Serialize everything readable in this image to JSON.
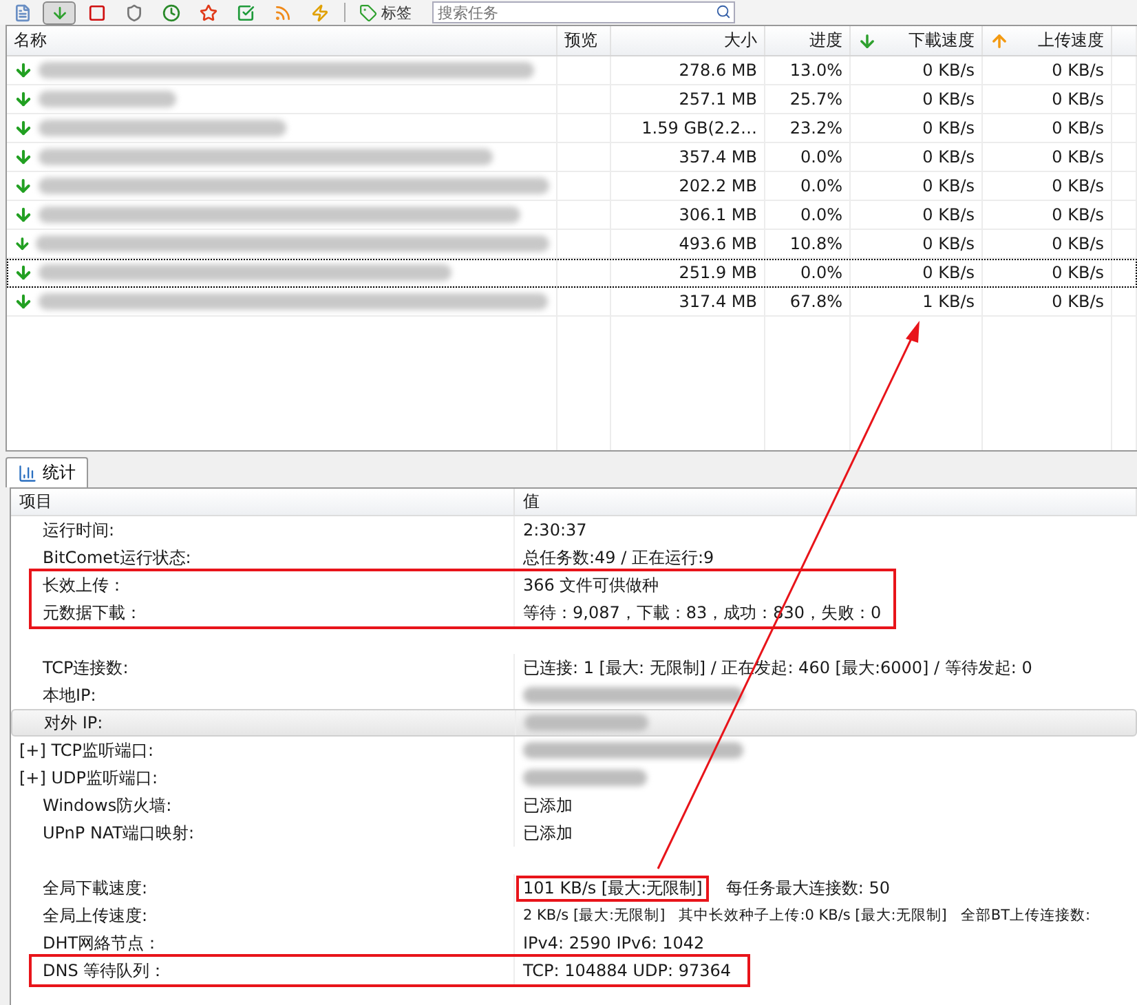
{
  "toolbar": {
    "buttons": [
      {
        "selected": false
      },
      {
        "selected": true
      },
      {
        "selected": false
      },
      {
        "selected": false
      },
      {
        "selected": false
      },
      {
        "selected": false
      },
      {
        "selected": false
      },
      {
        "selected": false
      },
      {
        "selected": false
      }
    ],
    "tag_button": "标签",
    "search": {
      "placeholder": "搜索任务"
    }
  },
  "tasks": {
    "columns": [
      "名称",
      "预览",
      "大小",
      "进度",
      "下載速度",
      "上传速度"
    ],
    "rows": [
      {
        "size": "278.6 MB",
        "progress": "13.0%",
        "down": "0 KB/s",
        "up": "0 KB/s",
        "focused": false
      },
      {
        "size": "257.1 MB",
        "progress": "25.7%",
        "down": "0 KB/s",
        "up": "0 KB/s",
        "focused": false
      },
      {
        "size": "1.59 GB(2.2…",
        "progress": "23.2%",
        "down": "0 KB/s",
        "up": "0 KB/s",
        "focused": false
      },
      {
        "size": "357.4 MB",
        "progress": "0.0%",
        "down": "0 KB/s",
        "up": "0 KB/s",
        "focused": false
      },
      {
        "size": "202.2 MB",
        "progress": "0.0%",
        "down": "0 KB/s",
        "up": "0 KB/s",
        "focused": false
      },
      {
        "size": "306.1 MB",
        "progress": "0.0%",
        "down": "0 KB/s",
        "up": "0 KB/s",
        "focused": false
      },
      {
        "size": "493.6 MB",
        "progress": "10.8%",
        "down": "0 KB/s",
        "up": "0 KB/s",
        "focused": false
      },
      {
        "size": "251.9 MB",
        "progress": "0.0%",
        "down": "0 KB/s",
        "up": "0 KB/s",
        "focused": true
      },
      {
        "size": "317.4 MB",
        "progress": "67.8%",
        "down": "1 KB/s",
        "up": "0 KB/s",
        "focused": false
      }
    ]
  },
  "bottom_tabs": [
    {
      "label": "统计",
      "selected": true
    }
  ],
  "stats": {
    "columns": [
      "项目",
      "值"
    ],
    "rows": [
      {
        "kind": "text",
        "label": "运行时间:",
        "value": [
          "2:30:37"
        ],
        "expandable": false,
        "selected": false
      },
      {
        "kind": "text",
        "label": "BitComet运行状态:",
        "value": [
          "总任务数:49 / 正在运行:9"
        ],
        "expandable": false,
        "selected": false
      },
      {
        "kind": "text",
        "label": "长效上传：",
        "value": [
          "366 文件可供做种"
        ],
        "expandable": false,
        "selected": false
      },
      {
        "kind": "text",
        "label": "元数据下載：",
        "value": [
          "等待：9,087，下載：83，成功：830，失败：0"
        ],
        "expandable": false,
        "selected": false
      },
      {
        "kind": "spacer"
      },
      {
        "kind": "text",
        "label": "TCP连接数:",
        "value": [
          "已连接: 1 [最大: 无限制] / 正在发起: 460 [最大:6000] / 等待发起: 0"
        ],
        "expandable": false,
        "selected": false
      },
      {
        "kind": "redacted",
        "label": "本地IP:",
        "expandable": false,
        "selected": false
      },
      {
        "kind": "redacted",
        "label": "对外 IP:",
        "expandable": false,
        "selected": true
      },
      {
        "kind": "redacted",
        "label": "[+] TCP监听端口:",
        "expandable": true,
        "selected": false
      },
      {
        "kind": "redacted",
        "label": "[+] UDP监听端口:",
        "expandable": true,
        "selected": false
      },
      {
        "kind": "text",
        "label": "Windows防火墙:",
        "value": [
          "已添加"
        ],
        "expandable": false,
        "selected": false
      },
      {
        "kind": "text",
        "label": "UPnP NAT端口映射:",
        "value": [
          "已添加"
        ],
        "expandable": false,
        "selected": false
      },
      {
        "kind": "spacer"
      },
      {
        "kind": "text",
        "label": "全局下載速度:",
        "value": [
          "101 KB/s [最大:无限制]",
          "每任务最大连接数: 50"
        ],
        "expandable": false,
        "selected": false
      },
      {
        "kind": "text",
        "label": "全局上传速度:",
        "value": [
          "2 KB/s [最大:无限制]",
          "其中长效种子上传:0 KB/s [最大:无限制]",
          "全部BT上传连接数:"
        ],
        "expandable": false,
        "selected": false
      },
      {
        "kind": "text",
        "label": "DHT网絡节点：",
        "value": [
          "IPv4: 2590  IPv6: 1042"
        ],
        "expandable": false,
        "selected": false
      },
      {
        "kind": "text",
        "label": "DNS 等待队列：",
        "value": [
          "TCP: 104884  UDP: 97364"
        ],
        "expandable": false,
        "selected": false
      }
    ]
  }
}
